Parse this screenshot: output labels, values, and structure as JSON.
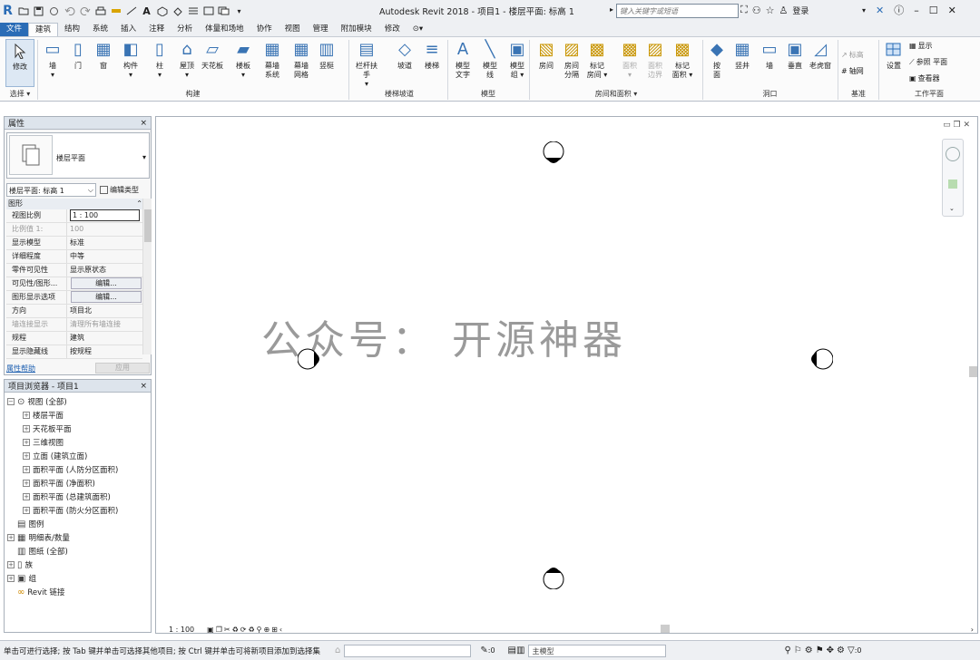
{
  "title": {
    "text": "Autodesk Revit 2018 -    项目1 - 楼层平面: 标高 1"
  },
  "search": {
    "placeholder": "键入关键字或短语"
  },
  "user": {
    "login": "登录"
  },
  "tabs": [
    "文件",
    "建筑",
    "结构",
    "系统",
    "插入",
    "注释",
    "分析",
    "体量和场地",
    "协作",
    "视图",
    "管理",
    "附加模块",
    "修改",
    "⊙▾"
  ],
  "ribbon": {
    "modify": "修改",
    "select": "选择 ▾",
    "build_group": "构建",
    "circulation_group": "楼梯坡道",
    "model_group": "模型",
    "room_group": "房间和面积 ▾",
    "opening_group": "洞口",
    "datum_group": "基准",
    "workplane_group": "工作平面",
    "buttons": [
      {
        "label": "墙",
        "sub": "▾"
      },
      {
        "label": "门",
        "sub": ""
      },
      {
        "label": "窗",
        "sub": ""
      },
      {
        "label": "构件",
        "sub": "▾"
      },
      {
        "label": "柱",
        "sub": "▾"
      },
      {
        "label": "屋顶",
        "sub": "▾"
      },
      {
        "label": "天花板",
        "sub": ""
      },
      {
        "label": "楼板",
        "sub": "▾"
      },
      {
        "label": "幕墙",
        "sub": "系统"
      },
      {
        "label": "幕墙",
        "sub": "网格"
      },
      {
        "label": "竖梃",
        "sub": ""
      },
      {
        "label": "栏杆扶手",
        "sub": "▾"
      },
      {
        "label": "坡道",
        "sub": ""
      },
      {
        "label": "楼梯",
        "sub": ""
      },
      {
        "label": "模型",
        "sub": "文字"
      },
      {
        "label": "模型",
        "sub": "线"
      },
      {
        "label": "模型",
        "sub": "组 ▾"
      },
      {
        "label": "房间",
        "sub": ""
      },
      {
        "label": "房间",
        "sub": "分隔"
      },
      {
        "label": "标记",
        "sub": "房间 ▾"
      },
      {
        "label": "面积",
        "sub": "▾"
      },
      {
        "label": "面积",
        "sub": "边界"
      },
      {
        "label": "标记",
        "sub": "面积 ▾"
      },
      {
        "label": "按",
        "sub": "面"
      },
      {
        "label": "竖井",
        "sub": ""
      },
      {
        "label": "墙",
        "sub": ""
      },
      {
        "label": "垂直",
        "sub": ""
      },
      {
        "label": "老虎窗",
        "sub": ""
      }
    ],
    "datum": {
      "level": "标高",
      "grid": "轴网"
    },
    "workplane": {
      "set": "设置",
      "show": "显示",
      "ref": "参照 平面",
      "viewer": "查看器"
    }
  },
  "properties": {
    "title": "属性",
    "close": "×",
    "type_name": "楼层平面",
    "instance": "楼层平面: 标高 1",
    "edit_type": "编辑类型",
    "category": "图形",
    "rows": [
      {
        "k": "视图比例",
        "v": "1 : 100",
        "kind": "input"
      },
      {
        "k": "比例值 1:",
        "v": "100",
        "kind": "grey"
      },
      {
        "k": "显示模型",
        "v": "标准",
        "kind": "text"
      },
      {
        "k": "详细程度",
        "v": "中等",
        "kind": "text"
      },
      {
        "k": "零件可见性",
        "v": "显示原状态",
        "kind": "text"
      },
      {
        "k": "可见性/图形...",
        "v": "编辑...",
        "kind": "button"
      },
      {
        "k": "图形显示选项",
        "v": "编辑...",
        "kind": "button"
      },
      {
        "k": "方向",
        "v": "项目北",
        "kind": "text"
      },
      {
        "k": "墙连接显示",
        "v": "清理所有墙连接",
        "kind": "grey"
      },
      {
        "k": "规程",
        "v": "建筑",
        "kind": "text"
      },
      {
        "k": "显示隐藏线",
        "v": "按规程",
        "kind": "text"
      }
    ],
    "help": "属性帮助",
    "apply": "应用"
  },
  "browser": {
    "title": "项目浏览器 - 项目1",
    "close": "×",
    "items": [
      {
        "label": "视图 (全部)",
        "exp": "−",
        "lvl": 0
      },
      {
        "label": "楼层平面",
        "exp": "+",
        "lvl": 1
      },
      {
        "label": "天花板平面",
        "exp": "+",
        "lvl": 1
      },
      {
        "label": "三维视图",
        "exp": "+",
        "lvl": 1
      },
      {
        "label": "立面 (建筑立面)",
        "exp": "+",
        "lvl": 1
      },
      {
        "label": "面积平面 (人防分区面积)",
        "exp": "+",
        "lvl": 1
      },
      {
        "label": "面积平面 (净面积)",
        "exp": "+",
        "lvl": 1
      },
      {
        "label": "面积平面 (总建筑面积)",
        "exp": "+",
        "lvl": 1
      },
      {
        "label": "面积平面 (防火分区面积)",
        "exp": "+",
        "lvl": 1
      },
      {
        "label": "图例",
        "exp": "",
        "lvl": 0
      },
      {
        "label": "明细表/数量",
        "exp": "+",
        "lvl": 0
      },
      {
        "label": "图纸 (全部)",
        "exp": "",
        "lvl": 0
      },
      {
        "label": "族",
        "exp": "+",
        "lvl": 0
      },
      {
        "label": "组",
        "exp": "+",
        "lvl": 0
      },
      {
        "label": "Revit 链接",
        "exp": "",
        "lvl": 0
      }
    ]
  },
  "canvas": {
    "watermark": "公众号： 开源神器",
    "scale": "1 : 100",
    "marker": "-"
  },
  "status": {
    "text": "单击可进行选择; 按 Tab 键并单击可选择其他项目; 按 Ctrl 键并单击可将新项目添加到选择集",
    "zero": ":0",
    "model": "主模型",
    "filter": ":0"
  },
  "colors": {
    "accent": "#2a6cb6",
    "panel": "#dde4ec"
  }
}
